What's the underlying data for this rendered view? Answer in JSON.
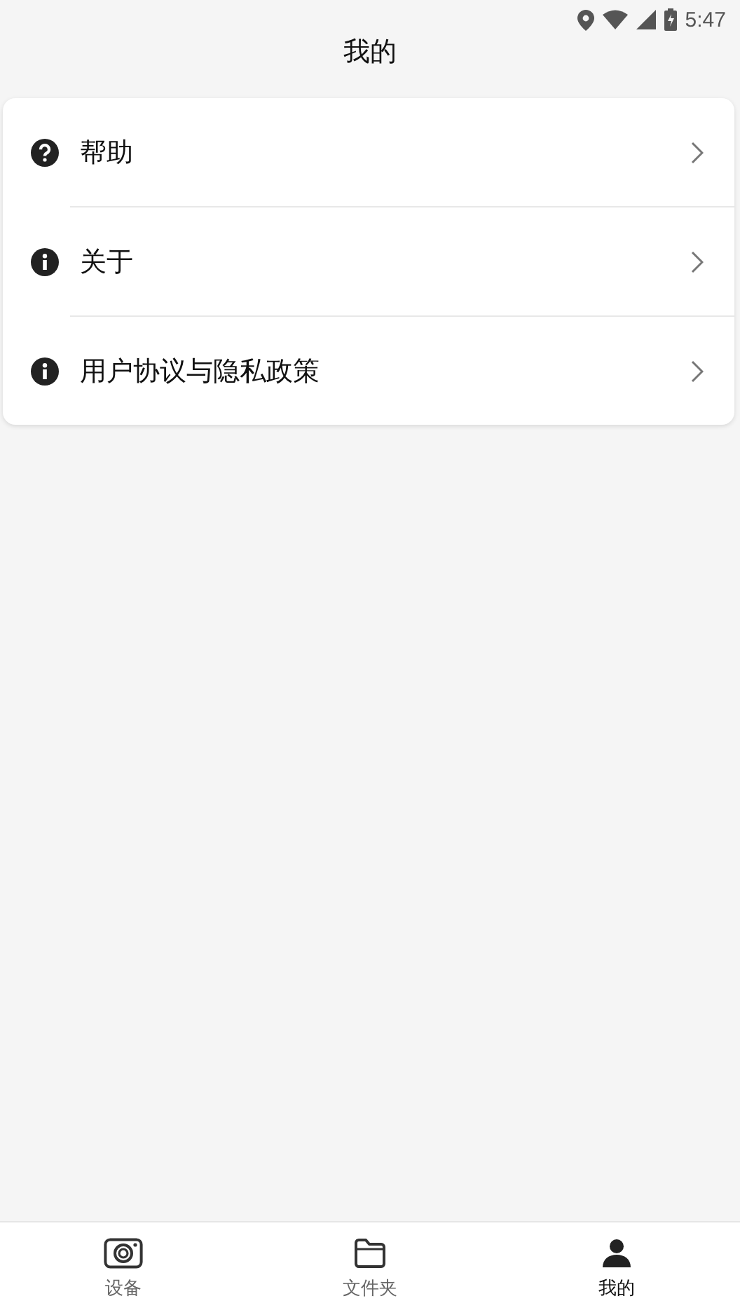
{
  "status_bar": {
    "time": "5:47"
  },
  "header": {
    "title": "我的"
  },
  "menu": [
    {
      "label": "帮助"
    },
    {
      "label": "关于"
    },
    {
      "label": "用户协议与隐私政策"
    }
  ],
  "tabs": [
    {
      "label": "设备",
      "selected": false
    },
    {
      "label": "文件夹",
      "selected": false
    },
    {
      "label": "我的",
      "selected": true
    }
  ]
}
